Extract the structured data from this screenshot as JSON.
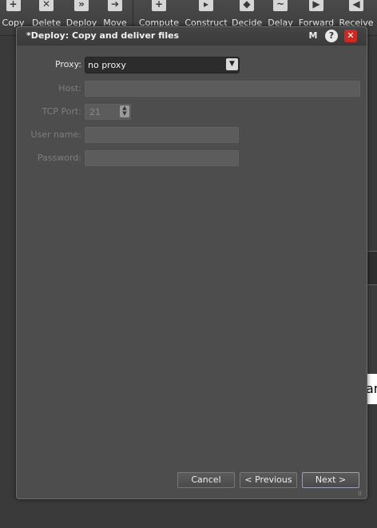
{
  "toolbar": {
    "items": [
      {
        "label": "Copy",
        "icon": "copy-icon"
      },
      {
        "label": "Delete",
        "icon": "delete-icon"
      },
      {
        "label": "Deploy",
        "icon": "deploy-icon"
      },
      {
        "label": "Move",
        "icon": "move-icon"
      },
      {
        "label": "Compute",
        "icon": "compute-icon"
      },
      {
        "label": "Construct",
        "icon": "construct-icon"
      },
      {
        "label": "Decide",
        "icon": "decide-icon"
      },
      {
        "label": "Delay",
        "icon": "delay-icon"
      },
      {
        "label": "Forward",
        "icon": "forward-icon"
      },
      {
        "label": "Receive",
        "icon": "receive-icon"
      }
    ]
  },
  "background": {
    "pane_text": "an"
  },
  "dialog": {
    "title": "*Deploy: Copy and deliver files",
    "title_buttons": {
      "m": "M",
      "help": "?",
      "close": "✕"
    },
    "fields": {
      "proxy": {
        "label": "Proxy:",
        "value": "no proxy"
      },
      "host": {
        "label": "Host:",
        "value": ""
      },
      "tcp_port": {
        "label": "TCP Port:",
        "value": "21"
      },
      "user_name": {
        "label": "User name:",
        "value": ""
      },
      "password": {
        "label": "Password:",
        "value": ""
      }
    },
    "buttons": {
      "cancel": "Cancel",
      "previous": "< Previous",
      "next": "Next >"
    }
  },
  "colors": {
    "dialog_bg": "#4d4d4d",
    "close_button": "#cc2a22",
    "disabled_field": "#5c5c5c"
  }
}
